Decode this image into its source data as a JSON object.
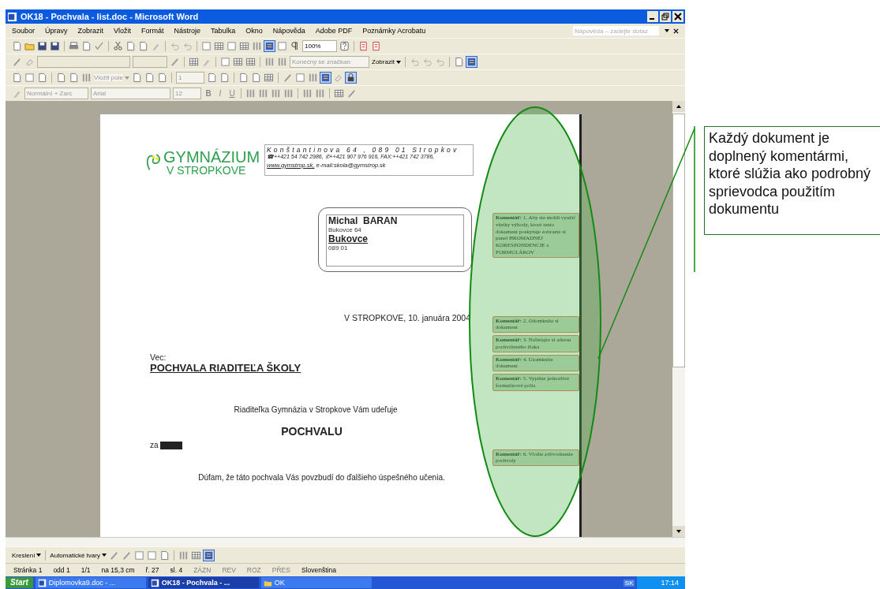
{
  "window": {
    "title": "OK18 - Pochvala - list.doc - Microsoft Word"
  },
  "menu": [
    {
      "label": "Soubor"
    },
    {
      "label": "Úpravy"
    },
    {
      "label": "Zobrazit"
    },
    {
      "label": "Vložit"
    },
    {
      "label": "Formát"
    },
    {
      "label": "Nástroje"
    },
    {
      "label": "Tabulka"
    },
    {
      "label": "Okno"
    },
    {
      "label": "Nápověda"
    },
    {
      "label": "Adobe PDF"
    },
    {
      "label": "Poznámky Acrobatu"
    }
  ],
  "help_box": {
    "placeholder": "Nápověda – zadejte dotaz"
  },
  "toolbars": {
    "zoom": "100%",
    "markup_view": "Konečný se značkan",
    "show_button": "Zobrazit",
    "insert_field": "Vložit pole",
    "record_number": "1",
    "style": "Normální + Zarc",
    "font": "Arial",
    "size": "12",
    "bold": "B",
    "italic": "I",
    "underline": "U"
  },
  "document": {
    "logo": {
      "line_1": "GYMNÁZIUM",
      "line_2": "V STROPKOVE"
    },
    "header": {
      "address": "Konštantinova 64 , 089 01 Stropkov",
      "phones": "☎++421 54 742 2986, ✆++421 907 976 916, FAX:++421 742 3786,",
      "web": "www.gymstrop.sk,",
      "email": "e-mail:skola@gymstrop.sk"
    },
    "recipient": {
      "name": "Michal  BARAN",
      "street": "Bukovce 64",
      "city": "Bukovce",
      "zip": "089 01"
    },
    "date": "V STROPKOVE, 10. januára 2004",
    "subject_label": "Vec:",
    "subject": "POCHVALA RIADITEĽA ŠKOLY",
    "intro": "Riaditeľka  Gymnázia v Stropkove Vám udeľuje",
    "award": "POCHVALU",
    "reason_label": "za",
    "closing": "Dúfam, že táto pochvala Vás povzbudí  do ďalšieho úspešného učenia.",
    "comments": [
      {
        "label": "Komentář:",
        "text": "1. Aby  ste mohli využiť všetky výhody, ktoré tento dokument poskytuje zobrazte si panel HROMADNEJ KORESPONDENCIE a FORMULÁROV"
      },
      {
        "label": "Komentář:",
        "text": "2. Odomknite si dokument"
      },
      {
        "label": "Komentář:",
        "text": "3. Nalistujte si adresu pochváleného žiaka"
      },
      {
        "label": "Komentář:",
        "text": "4. Uzamknite dokument"
      },
      {
        "label": "Komentář:",
        "text": "5. Vyplňte jednotlivé formulárové polia"
      },
      {
        "label": "Komentář:",
        "text": "6. Vložte zdôvodnenie pochvaly"
      }
    ]
  },
  "drawing_toolbar": {
    "draw_menu": "Kreslení",
    "autoshapes_menu": "Automatické tvary"
  },
  "status_bar": [
    "Stránka 1",
    "odd 1",
    "1/1",
    "na 15,3 cm",
    "ř. 27",
    "sl. 4",
    "ZÁZN",
    "REV",
    "ROZ",
    "PŘES",
    "Slovenština"
  ],
  "taskbar": {
    "start": "Start",
    "tasks": [
      {
        "label": "Diplomovka9.doc - ...",
        "selected": false,
        "kind": "doc"
      },
      {
        "label": "OK18 - Pochvala - ...",
        "selected": true,
        "kind": "doc"
      },
      {
        "label": "OK",
        "selected": false,
        "kind": "folder"
      }
    ],
    "language": "SK",
    "clock": "17:14"
  },
  "callout": {
    "text": "Každý dokument je doplnený komentármi, ktoré slúžia ako podrobný sprievodca použitím dokumentu"
  }
}
